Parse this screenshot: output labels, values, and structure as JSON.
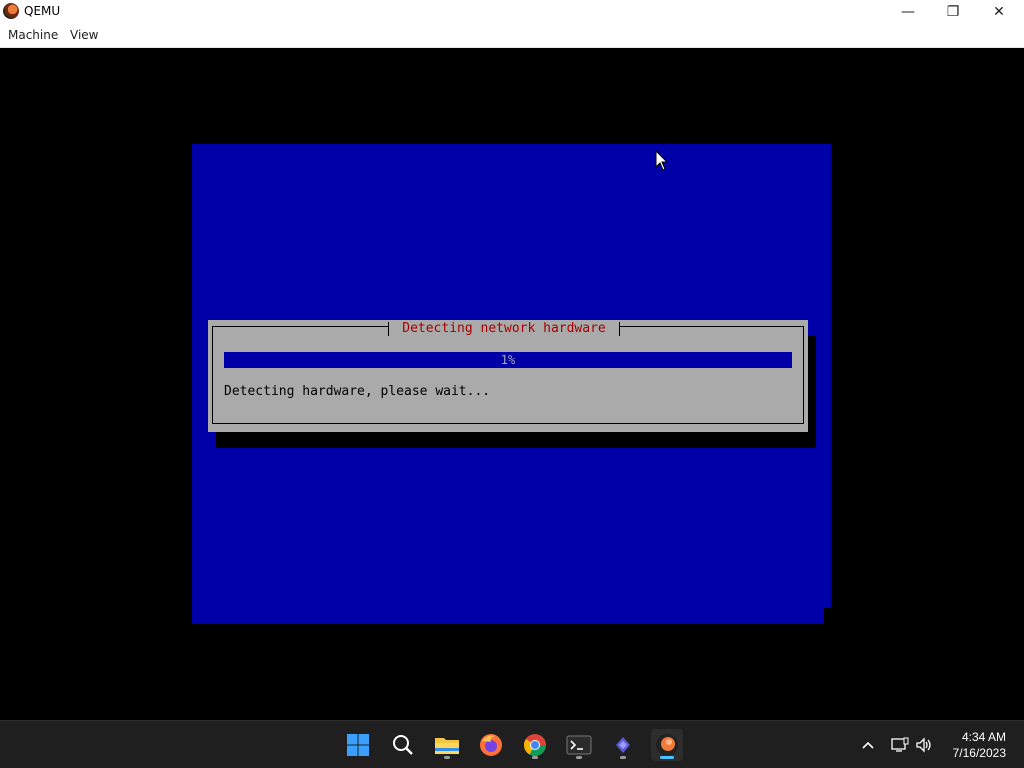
{
  "window": {
    "title": "QEMU",
    "controls": {
      "minimize": "—",
      "maximize": "❐",
      "close": "✕"
    }
  },
  "menu": {
    "items": [
      "Machine",
      "View"
    ]
  },
  "installer": {
    "dialog_title": "Detecting network hardware",
    "progress": {
      "percent": 1,
      "label": "1%"
    },
    "status": "Detecting hardware, please wait..."
  },
  "taskbar": {
    "apps": [
      "start-icon",
      "search-icon",
      "file-explorer-icon",
      "firefox-icon",
      "chrome-icon",
      "terminal-icon",
      "app-icon",
      "qemu-icon"
    ],
    "tray": [
      "chevron-up-icon",
      "network-icon",
      "volume-icon"
    ],
    "clock": {
      "time": "4:34 AM",
      "date": "7/16/2023"
    }
  },
  "colors": {
    "installer_bg": "#0000a8",
    "dialog_bg": "#aaaaaa",
    "dialog_title": "#a80000",
    "taskbar": "#1f1f1f"
  }
}
